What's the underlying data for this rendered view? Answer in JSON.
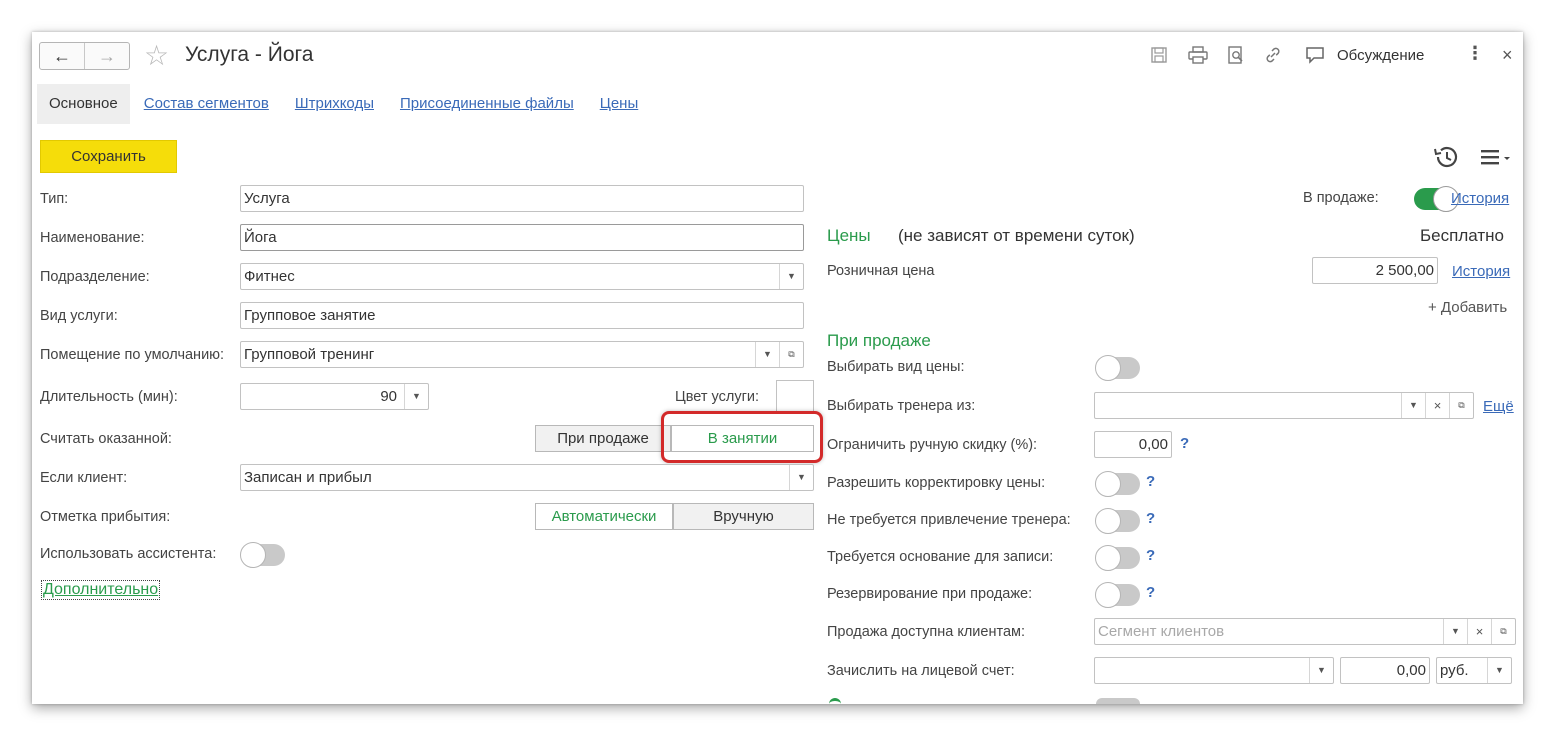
{
  "window": {
    "title": "Услуга - Йога",
    "discuss_label": "Обсуждение"
  },
  "tabs": [
    {
      "label": "Основное",
      "active": true
    },
    {
      "label": "Состав сегментов"
    },
    {
      "label": "Штрихкоды"
    },
    {
      "label": "Присоединенные файлы"
    },
    {
      "label": "Цены"
    }
  ],
  "toolbar": {
    "save_label": "Сохранить"
  },
  "left": {
    "type_label": "Тип:",
    "type_value": "Услуга",
    "name_label": "Наименование:",
    "name_value": "Йога",
    "division_label": "Подразделение:",
    "division_value": "Фитнес",
    "service_kind_label": "Вид услуги:",
    "service_kind_value": "Групповое занятие",
    "room_label": "Помещение по умолчанию:",
    "room_value": "Групповой тренинг",
    "duration_label": "Длительность (мин):",
    "duration_value": "90",
    "color_label": "Цвет услуги:",
    "count_done_label": "Считать оказанной:",
    "count_done_option1": "При продаже",
    "count_done_option2": "В занятии",
    "if_client_label": "Если клиент:",
    "if_client_value": "Записан и прибыл",
    "arrival_label": "Отметка прибытия:",
    "arrival_option1": "Автоматически",
    "arrival_option2": "Вручную",
    "assistant_label": "Использовать ассистента:",
    "additional_link": "Дополнительно"
  },
  "right": {
    "on_sale_label": "В продаже:",
    "history_link": "История",
    "prices_title": "Цены",
    "prices_note": "(не зависят от времени суток)",
    "free_label": "Бесплатно",
    "retail_price_label": "Розничная цена",
    "retail_price_value": "2 500,00",
    "retail_history_link": "История",
    "add_link": "+ Добавить",
    "on_sale_section": "При продаже",
    "choose_price_kind_label": "Выбирать вид цены:",
    "choose_trainer_label": "Выбирать тренера из:",
    "more_link": "Ещё",
    "limit_discount_label": "Ограничить ручную скидку (%):",
    "limit_discount_value": "0,00",
    "allow_price_edit_label": "Разрешить корректировку цены:",
    "no_trainer_label": "Не требуется привлечение тренера:",
    "basis_required_label": "Требуется основание для записи:",
    "reserve_label": "Резервирование при продаже:",
    "available_clients_label": "Продажа доступна клиентам:",
    "available_clients_placeholder": "Сегмент клиентов",
    "credit_account_label": "Зачислить на лицевой счет:",
    "credit_amount": "0,00",
    "currency": "руб.",
    "help_mark": "?"
  },
  "colors": {
    "accent_green": "#2a9b4c",
    "link_blue": "#3a6ab8",
    "save_yellow": "#f5dd0a",
    "highlight_red": "#d32a2a"
  }
}
